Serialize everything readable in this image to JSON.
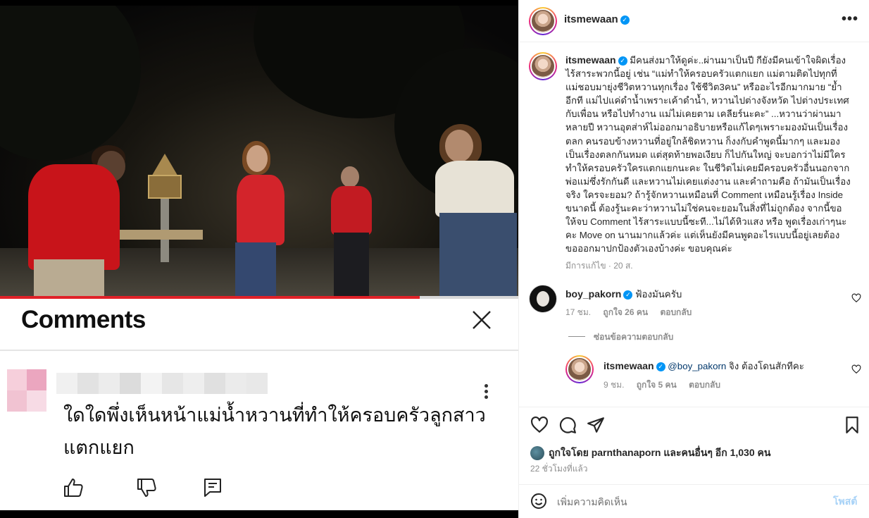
{
  "media": {
    "video_progress": 0.81,
    "comments_panel": {
      "title": "Comments",
      "comment_text": "ใดใดพึ่งเห็นหน้าแม่น้ำหวานที่ทำให้ครอบครัวลูกสาวแตกแยก",
      "icons": [
        "close-icon",
        "more-vertical-icon",
        "thumb-up-icon",
        "thumb-down-icon",
        "reply-icon"
      ]
    }
  },
  "post": {
    "author": "itsmewaan",
    "more_label": "•••",
    "caption": {
      "username": "itsmewaan",
      "text": "มีคนส่งมาให้ดูค่ะ..ผ่านมาเป็นปี กียังมีคนเข้าใจผิดเรื่องไร้สาระพวกนี้อยู่ เช่น “แม่ทำให้ครอบครัวแตกแยก แม่ตามติดไปทุกที่ แม่ชอบมายุ่งชีวิตหวานทุกเรื่อง ใช้ชีวิต3คน” หรืออะไรอีกมากมาย “ย้ำอีกที แม่ไปแค่ดำน้ำเพราะเค้าดำน้ำ, หวานไปต่างจังหวัด ไปต่างประเทศกับเพื่อน หรือไปทำงาน แม่ไม่เคยตาม เคลียร์นะคะ” ...หวานว่าผ่านมาหลายปี หวานอุตส่าห์ไม่ออกมาอธิบายหรือแก้ไดๆเพราะมองมันเป็นเรื่องตลก คนรอบข้างหวานที่อยู่ใกล้ชิดหวาน ก็งงกับคำพูดนี้มากๆ และมองเป็นเรื่องตลกกันหมด แต่สุดท้ายพอเงียบ ก็ไปกันใหญ่ จะบอกว่าไม่มีใครทำให้ครอบครัวใครแตกแยกนะคะ ในชีวิตไม่เคยมีครอบครัวอื่นนอกจากพ่อแม่ซึ่งรักกันดี และหวานไม่เคยแต่งงาน และคำถามคือ ถ้ามันเป็นเรื่องจริง ใครจะยอม? ถ้ารู้จักหวานเหมือนที่ Comment เหมือนรู้เรื่อง Inside ขนาดนี้ ต้องรู้นะคะว่าหวานไม่ใช่คนจะยอมในสิ่งที่ไม่ถูกต้อง จากนี้ขอให้จบ Comment ไร้สาระแบบนี้ซะที...ไม่ได้หิวแสง หรือ พูดเรื่องเก่าๆนะคะ Move on นานมากแล้วค่ะ แต่เห็นยังมีคนพูดอะไรแบบนี้อยู่เลยต้องขอออกมาปกป้องตัวเองบ้างค่ะ ขอบคุณค่ะ",
      "meta": "มีการแก้ไข · 20 ส."
    },
    "comments": [
      {
        "username": "boy_pakorn",
        "text": "ฟ้องมันครับ",
        "time": "17 ชม.",
        "likes": "ถูกใจ 26 คน",
        "reply_label": "ตอบกลับ"
      }
    ],
    "replies_toggle": "ซ่อนข้อความตอบกลับ",
    "reply": {
      "username": "itsmewaan",
      "mention": "@boy_pakorn",
      "text": " จิง ต้องโดนสักทีคะ",
      "time": "9 ชม.",
      "likes": "ถูกใจ 5 คน",
      "reply_label": "ตอบกลับ"
    },
    "likes_text": "ถูกใจโดย parnthanaporn และคนอื่นๆ อีก 1,030 คน",
    "time_ago": "22 ชั่วโมงที่แล้ว",
    "composer": {
      "placeholder": "เพิ่มความคิดเห็น",
      "post_label": "โพสต์"
    },
    "colors": {
      "verified": "#0095f6",
      "post_button": "#a7d2f7",
      "mention": "#00376b",
      "progress": "#e02128"
    }
  }
}
